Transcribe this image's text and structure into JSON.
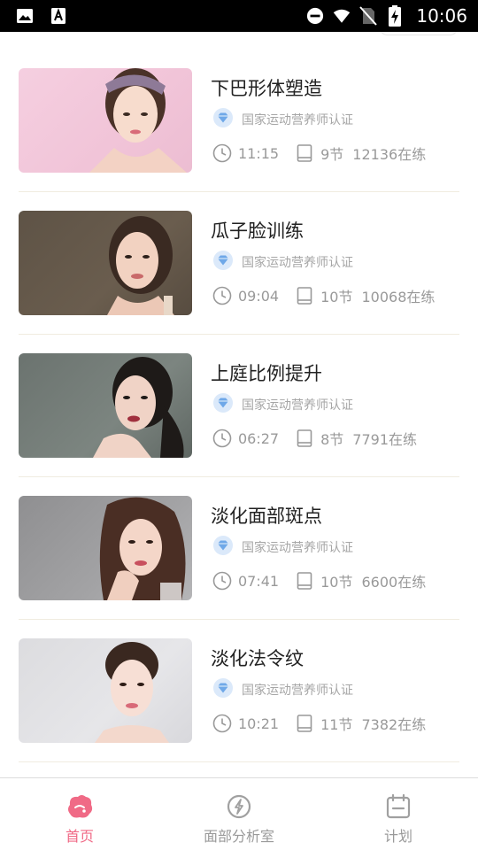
{
  "status_bar": {
    "time": "10:06",
    "icons": [
      "image-icon",
      "font-a-icon",
      "do-not-disturb-icon",
      "wifi-icon",
      "no-sim-icon",
      "battery-charging-icon"
    ]
  },
  "courses": [
    {
      "title": "下巴形体塑造",
      "cert": "国家运动营养师认证",
      "duration": "11:15",
      "sections": "9节",
      "learners": "12136在练"
    },
    {
      "title": "瓜子脸训练",
      "cert": "国家运动营养师认证",
      "duration": "09:04",
      "sections": "10节",
      "learners": "10068在练"
    },
    {
      "title": "上庭比例提升",
      "cert": "国家运动营养师认证",
      "duration": "06:27",
      "sections": "8节",
      "learners": "7791在练"
    },
    {
      "title": "淡化面部斑点",
      "cert": "国家运动营养师认证",
      "duration": "07:41",
      "sections": "10节",
      "learners": "6600在练"
    },
    {
      "title": "淡化法令纹",
      "cert": "国家运动营养师认证",
      "duration": "10:21",
      "sections": "11节",
      "learners": "7382在练"
    }
  ],
  "tabs": [
    {
      "label": "首页",
      "icon": "home-icon",
      "active": true
    },
    {
      "label": "面部分析室",
      "icon": "analysis-icon",
      "active": false
    },
    {
      "label": "计划",
      "icon": "calendar-icon",
      "active": false
    }
  ],
  "colors": {
    "accent": "#f06a86",
    "cert_badge": "#6fa8e8",
    "inactive": "#9a9a9a",
    "divider": "#f0ece0"
  }
}
